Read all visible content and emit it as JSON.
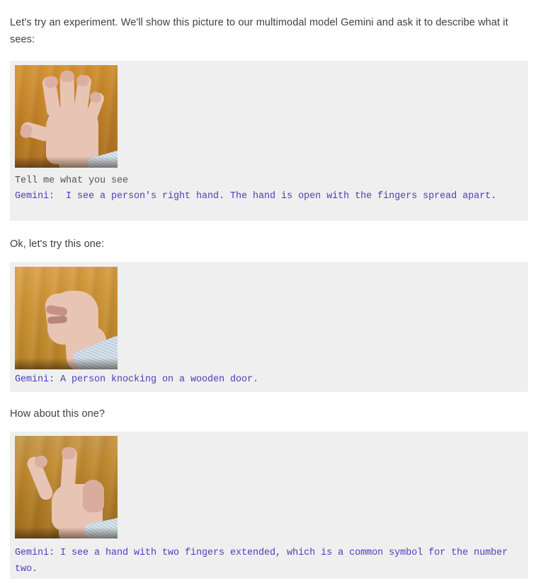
{
  "page": {
    "background_color": "#ffffff",
    "panel_color": "#efefef",
    "narrative_text_color": "#3c4043",
    "user_text_color": "#545454",
    "gemini_text_color": "#4b3fbb"
  },
  "narrative": {
    "intro": "Let's try an experiment. We'll show this picture to our multimodal model Gemini and ask it to describe what it sees:",
    "lead_in_2": "Ok, let's try this one:",
    "lead_in_3": "How about this one?"
  },
  "exchanges": [
    {
      "image_alt": "open-hand-photo",
      "image_description": "Photograph of an open right hand with fingers spread apart, palm down on a wooden tabletop",
      "user_prompt": "Tell me what you see",
      "gemini_reply": "Gemini:  I see a person's right hand. The hand is open with the fingers spread apart."
    },
    {
      "image_alt": "closed-fist-photo",
      "image_description": "Photograph of a closed fist resting on a wooden tabletop with a light blue shirt cuff visible",
      "user_prompt": "",
      "gemini_reply": "Gemini: A person knocking on a wooden door."
    },
    {
      "image_alt": "two-fingers-photo",
      "image_description": "Photograph of a hand making a V / peace sign with two fingers extended on a wooden tabletop",
      "user_prompt": "",
      "gemini_reply": "Gemini: I see a hand with two fingers extended, which is a common symbol for the number two."
    }
  ]
}
